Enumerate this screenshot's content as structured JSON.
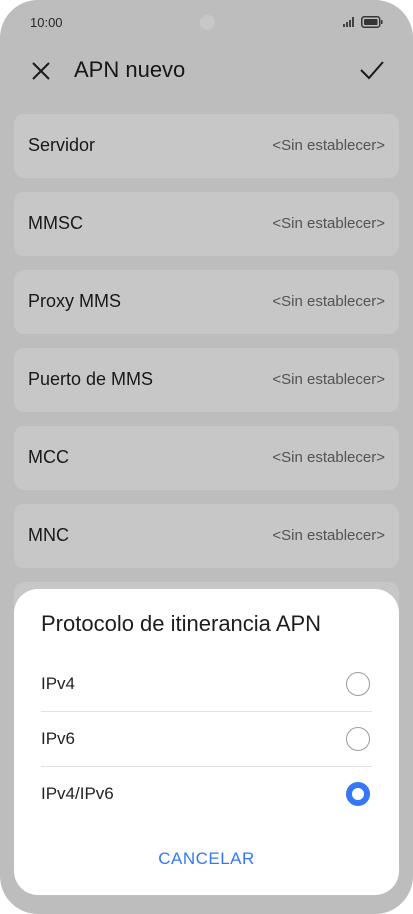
{
  "status_bar": {
    "time": "10:00"
  },
  "app_bar": {
    "title": "APN nuevo",
    "close_icon": "close-icon",
    "confirm_icon": "check-icon"
  },
  "fields": [
    {
      "label": "Servidor",
      "value": "<Sin establecer>"
    },
    {
      "label": "MMSC",
      "value": "<Sin establecer>"
    },
    {
      "label": "Proxy MMS",
      "value": "<Sin establecer>"
    },
    {
      "label": "Puerto de MMS",
      "value": "<Sin establecer>"
    },
    {
      "label": "MCC",
      "value": "<Sin establecer>"
    },
    {
      "label": "MNC",
      "value": "<Sin establecer>"
    }
  ],
  "dialog": {
    "title": "Protocolo de itinerancia APN",
    "options": [
      {
        "label": "IPv4",
        "selected": false
      },
      {
        "label": "IPv6",
        "selected": false
      },
      {
        "label": "IPv4/IPv6",
        "selected": true
      }
    ],
    "cancel_label": "CANCELAR"
  },
  "colors": {
    "accent": "#3478f6",
    "background": "#f2f2f2",
    "card": "#ffffff"
  }
}
